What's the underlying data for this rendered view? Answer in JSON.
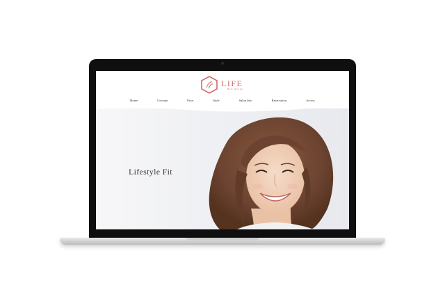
{
  "site": {
    "logo": {
      "word": "LIFE",
      "sub": "Hair Design"
    },
    "nav": [
      "Home",
      "Concept",
      "Price",
      "Style",
      "Salon Info",
      "Reservation",
      "Access"
    ],
    "hero": {
      "title": "Lifestyle Fit"
    }
  },
  "colors": {
    "brand": "#d46a6e",
    "bezel": "#0f0f10"
  },
  "icons": {
    "logo": "hexagon-logo-icon"
  }
}
